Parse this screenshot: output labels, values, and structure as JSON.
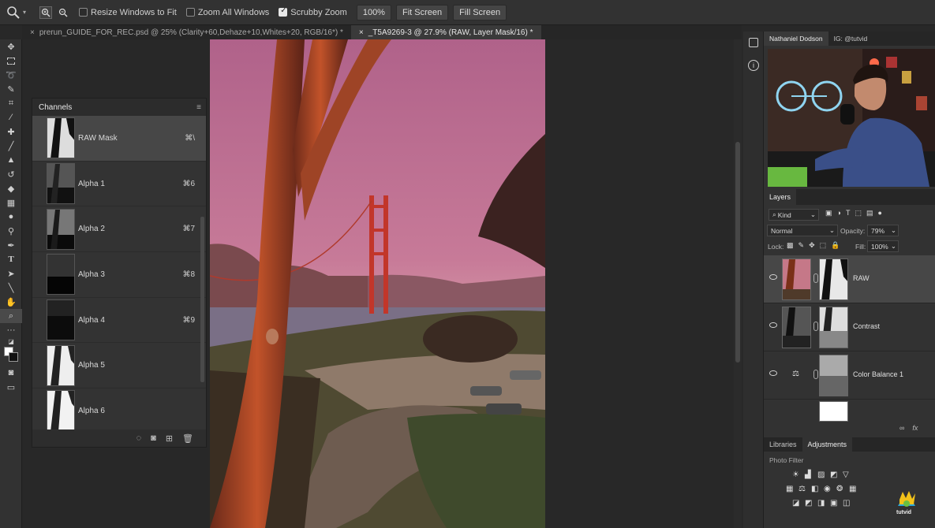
{
  "options_bar": {
    "resize_windows": "Resize Windows to Fit",
    "zoom_all": "Zoom All Windows",
    "scrubby_zoom": "Scrubby Zoom",
    "zoom_level": "100%",
    "fit_screen": "Fit Screen",
    "fill_screen": "Fill Screen",
    "resize_checked": false,
    "zoom_all_checked": false,
    "scrubby_checked": true
  },
  "tabs": [
    {
      "label": "prerun_GUIDE_FOR_REC.psd @ 25% (Clarity+60,Dehaze+10,Whites+20, RGB/16*) *"
    },
    {
      "label": "_T5A9269-3 @ 27.9% (RAW, Layer Mask/16) *"
    }
  ],
  "channels": {
    "title": "Channels",
    "items": [
      {
        "name": "RAW Mask",
        "key": "⌘\\"
      },
      {
        "name": "Alpha 1",
        "key": "⌘6"
      },
      {
        "name": "Alpha 2",
        "key": "⌘7"
      },
      {
        "name": "Alpha 3",
        "key": "⌘8"
      },
      {
        "name": "Alpha 4",
        "key": "⌘9"
      },
      {
        "name": "Alpha 5",
        "key": ""
      },
      {
        "name": "Alpha 6",
        "key": ""
      }
    ]
  },
  "webcam": {
    "name": "Nathaniel Dodson",
    "handle": "IG: @tutvid"
  },
  "layers": {
    "title": "Layers",
    "kind": "Kind",
    "blend_mode": "Normal",
    "opacity_label": "Opacity:",
    "opacity": "79%",
    "lock_label": "Lock:",
    "fill_label": "Fill:",
    "fill": "100%",
    "items": [
      {
        "name": "RAW"
      },
      {
        "name": "Contrast"
      },
      {
        "name": "Color Balance 1"
      }
    ]
  },
  "adjustments": {
    "tab_libraries": "Libraries",
    "tab_adjustments": "Adjustments",
    "hovered": "Photo Filter"
  },
  "brand": "tutvid",
  "colors": {
    "ui_bg": "#323232",
    "selection": "#474747",
    "sky": "#c06a88"
  }
}
